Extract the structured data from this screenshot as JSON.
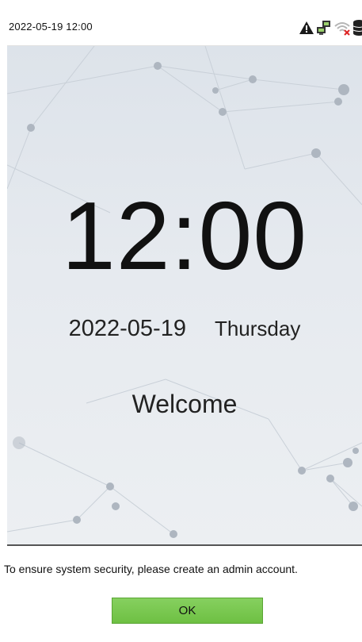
{
  "status_bar": {
    "datetime": "2022-05-19 12:00",
    "icons": [
      "warning-icon",
      "network-icon",
      "wifi-disconnected-icon",
      "database-icon"
    ]
  },
  "main": {
    "clock": "12:00",
    "date": "2022-05-19",
    "weekday": "Thursday",
    "welcome": "Welcome"
  },
  "dialog": {
    "message": "To ensure system security, please create an admin account.",
    "ok_label": "OK"
  },
  "colors": {
    "ok_button": "#78c84f",
    "background": "#e3e8ee",
    "text": "#111111"
  }
}
